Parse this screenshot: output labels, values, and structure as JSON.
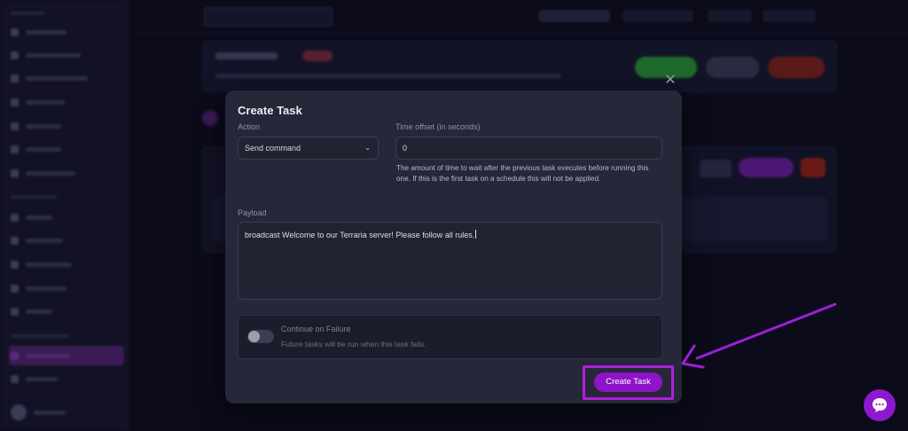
{
  "modal": {
    "title": "Create Task",
    "close_icon": "close-icon",
    "action": {
      "label": "Action",
      "value": "Send command"
    },
    "time_offset": {
      "label": "Time offset (in seconds)",
      "value": "0",
      "help": "The amount of time to wait after the previous task executes before running this one. If this is the first task on a schedule this will not be applied."
    },
    "payload": {
      "label": "Payload",
      "value": "broadcast Welcome to our Terraria server! Please follow all rules."
    },
    "continue_on_failure": {
      "label": "Continue on Failure",
      "description": "Future tasks will be run when this task fails.",
      "enabled": false
    },
    "submit_label": "Create Task"
  },
  "colors": {
    "accent": "#8e13c9",
    "highlight": "#b21ee0",
    "modal_bg": "#262738",
    "page_bg": "#0b0b1a"
  },
  "chat_icon": "chat-bubble-icon"
}
